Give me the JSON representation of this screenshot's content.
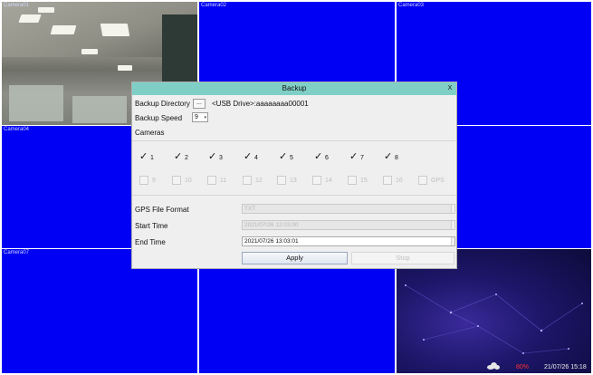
{
  "cameras": [
    {
      "label": "Camera01"
    },
    {
      "label": "Camera02"
    },
    {
      "label": "Camera03"
    },
    {
      "label": "Camera04"
    },
    {
      "label": ""
    },
    {
      "label": ""
    },
    {
      "label": "Camera07"
    },
    {
      "label": ""
    },
    {
      "label": ""
    }
  ],
  "dialog": {
    "title": "Backup",
    "close": "X",
    "backup_directory_label": "Backup Directory",
    "browse_label": "...",
    "directory_value": "<USB Drive>:aaaaaaaa00001",
    "backup_speed_label": "Backup Speed",
    "backup_speed_value": "9",
    "cameras_label": "Cameras",
    "camera_checks": [
      {
        "label": "1",
        "checked": true
      },
      {
        "label": "2",
        "checked": true
      },
      {
        "label": "3",
        "checked": true
      },
      {
        "label": "4",
        "checked": true
      },
      {
        "label": "5",
        "checked": true
      },
      {
        "label": "6",
        "checked": true
      },
      {
        "label": "7",
        "checked": true
      },
      {
        "label": "8",
        "checked": true
      },
      {
        "label": "9",
        "checked": false
      },
      {
        "label": "10",
        "checked": false
      },
      {
        "label": "11",
        "checked": false
      },
      {
        "label": "12",
        "checked": false
      },
      {
        "label": "13",
        "checked": false
      },
      {
        "label": "14",
        "checked": false
      },
      {
        "label": "15",
        "checked": false
      },
      {
        "label": "16",
        "checked": false
      },
      {
        "label": "GPS",
        "checked": false
      }
    ],
    "gps_format_label": "GPS File Format",
    "gps_format_value": "TXT",
    "start_time_label": "Start Time",
    "start_time_value": "2021/07/26 12:03:00",
    "end_time_label": "End Time",
    "end_time_value": "2021/07/26 13:03:01",
    "apply_label": "Apply",
    "stop_label": "Stop"
  },
  "status": {
    "percent": "80%",
    "datetime": "21/07/26 15:18"
  },
  "colors": {
    "camera_bg": "#0000f4",
    "titlebar": "#7fcfc6",
    "percent": "#ff3030"
  },
  "icons": [
    "cloud-icon",
    "close-icon",
    "checkmark-icon"
  ]
}
